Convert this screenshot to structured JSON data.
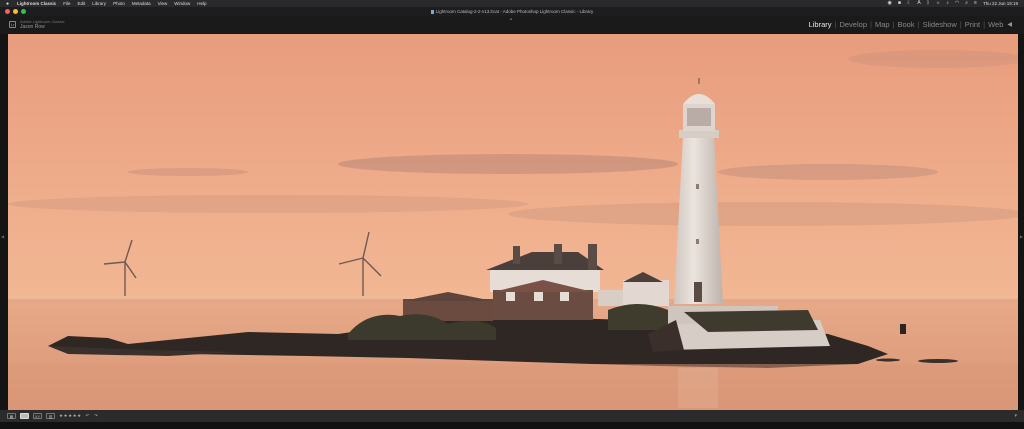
{
  "menubar": {
    "apple": "",
    "items": [
      "Lightroom Classic",
      "File",
      "Edit",
      "Library",
      "Photo",
      "Metadata",
      "View",
      "Window",
      "Help"
    ],
    "clock": "Thu 22 Jun  19:19",
    "status_icons": [
      "screen-record-icon",
      "stop-icon",
      "focus-icon",
      "text-input-icon",
      "bluetooth-icon",
      "brightness-icon",
      "volume-icon",
      "wifi-icon",
      "search-icon",
      "control-center-icon"
    ]
  },
  "window": {
    "title": "Lightroom Catalog-2-2-v13.lrcat - Adobe Photoshop Lightroom Classic - Library"
  },
  "identity": {
    "badge": "Lr",
    "sub": "Adobe Lightroom Classic",
    "name": "Jason Row"
  },
  "modules": [
    "Library",
    "Develop",
    "Map",
    "Book",
    "Slideshow",
    "Print",
    "Web"
  ],
  "active_module": "Library",
  "toolbar": {
    "view_modes": [
      "grid-view-icon",
      "loupe-view-icon",
      "compare-view-icon",
      "survey-view-icon"
    ],
    "rating": "★★★★★",
    "rotate_left": "↶",
    "rotate_right": "↷"
  },
  "colors": {
    "sky_top": "#e9a07f",
    "sky_bottom": "#f0b08c",
    "sea": "#e6a886",
    "land": "#2e2723",
    "lighthouse": "#e4dbd4",
    "accent_active": "#e8e8e8"
  }
}
